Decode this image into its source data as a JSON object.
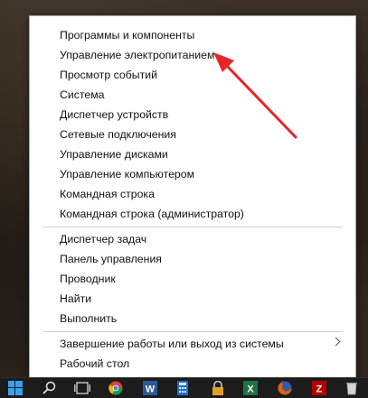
{
  "context_menu": {
    "items": [
      {
        "label": "Программы и компоненты"
      },
      {
        "label": "Управление электропитанием"
      },
      {
        "label": "Просмотр событий"
      },
      {
        "label": "Система"
      },
      {
        "label": "Диспетчер устройств"
      },
      {
        "label": "Сетевые подключения"
      },
      {
        "label": "Управление дисками"
      },
      {
        "label": "Управление компьютером"
      },
      {
        "label": "Командная строка"
      },
      {
        "label": "Командная строка (администратор)"
      },
      {
        "label": "Диспетчер задач"
      },
      {
        "label": "Панель управления"
      },
      {
        "label": "Проводник"
      },
      {
        "label": "Найти"
      },
      {
        "label": "Выполнить"
      },
      {
        "label": "Завершение работы или выход из системы"
      },
      {
        "label": "Рабочий стол"
      }
    ]
  },
  "annotation": {
    "arrow_color": "#e8262a"
  },
  "taskbar": {
    "icons": [
      "windows-start-icon",
      "search-icon",
      "task-view-icon",
      "chrome-icon",
      "word-icon",
      "calculator-icon",
      "lock-icon",
      "excel-icon",
      "firefox-icon",
      "filezilla-icon",
      "recycle-bin-icon"
    ]
  }
}
